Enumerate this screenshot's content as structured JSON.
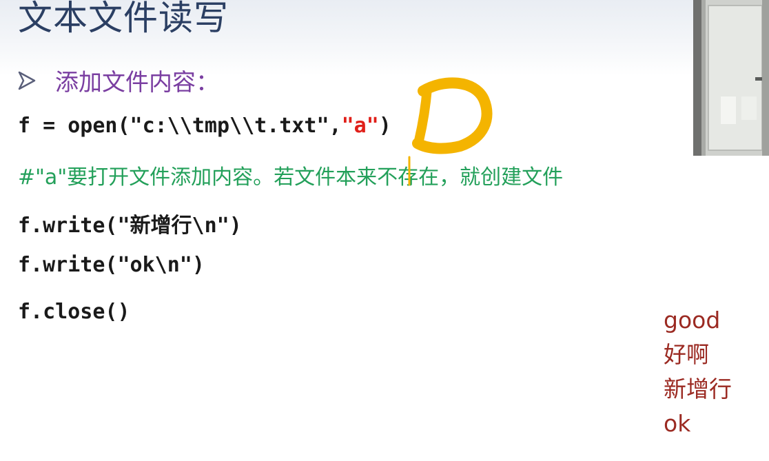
{
  "slide": {
    "title": "文本文件读写",
    "bullet": "添加文件内容："
  },
  "code": {
    "line1_prefix": "f = open(\"c:\\\\tmp\\\\t.txt\",",
    "line1_mode": "\"a\"",
    "line1_suffix": ")",
    "comment": "#\"a\"要打开文件添加内容。若文件本来不存在，就创建文件",
    "line3": "f.write(\"新增行\\n\")",
    "line4": "f.write(\"ok\\n\")",
    "line5": "f.close()"
  },
  "file_output": [
    "good",
    "好啊",
    "新增行",
    "ok"
  ],
  "colors": {
    "title": "#2b3f63",
    "bullet": "#7a3ea1",
    "comment": "#23a05a",
    "mode_string": "#e0201a",
    "file_output": "#9b2a22",
    "annotation": "#f4b400"
  }
}
